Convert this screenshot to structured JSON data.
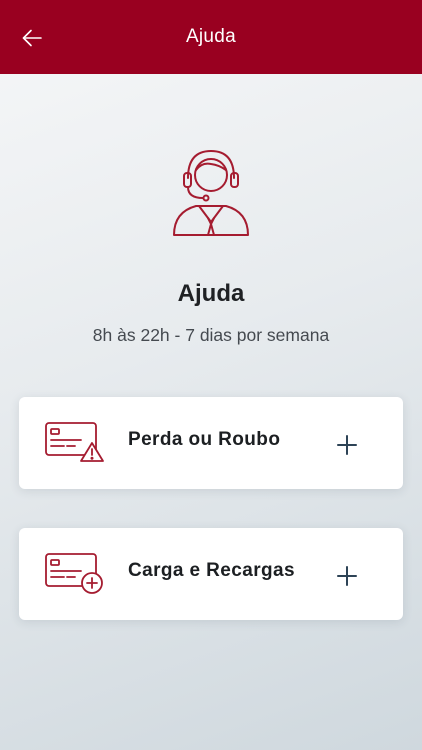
{
  "header": {
    "title": "Ajuda",
    "back_icon": "arrow-left-icon"
  },
  "hero": {
    "icon": "support-agent-headset-icon",
    "title": "Ajuda",
    "subtitle": "8h às 22h - 7 dias por semana"
  },
  "cards": [
    {
      "icon": "card-warning-icon",
      "label": "Perda ou Roubo",
      "action_icon": "plus-icon"
    },
    {
      "icon": "card-add-icon",
      "label": "Carga e Recargas",
      "action_icon": "plus-icon"
    }
  ],
  "colors": {
    "brand": "#990020",
    "icon_accent": "#a51c30",
    "plus": "#2d4356",
    "title_text": "#1f2124",
    "subtitle_text": "#454a50"
  }
}
